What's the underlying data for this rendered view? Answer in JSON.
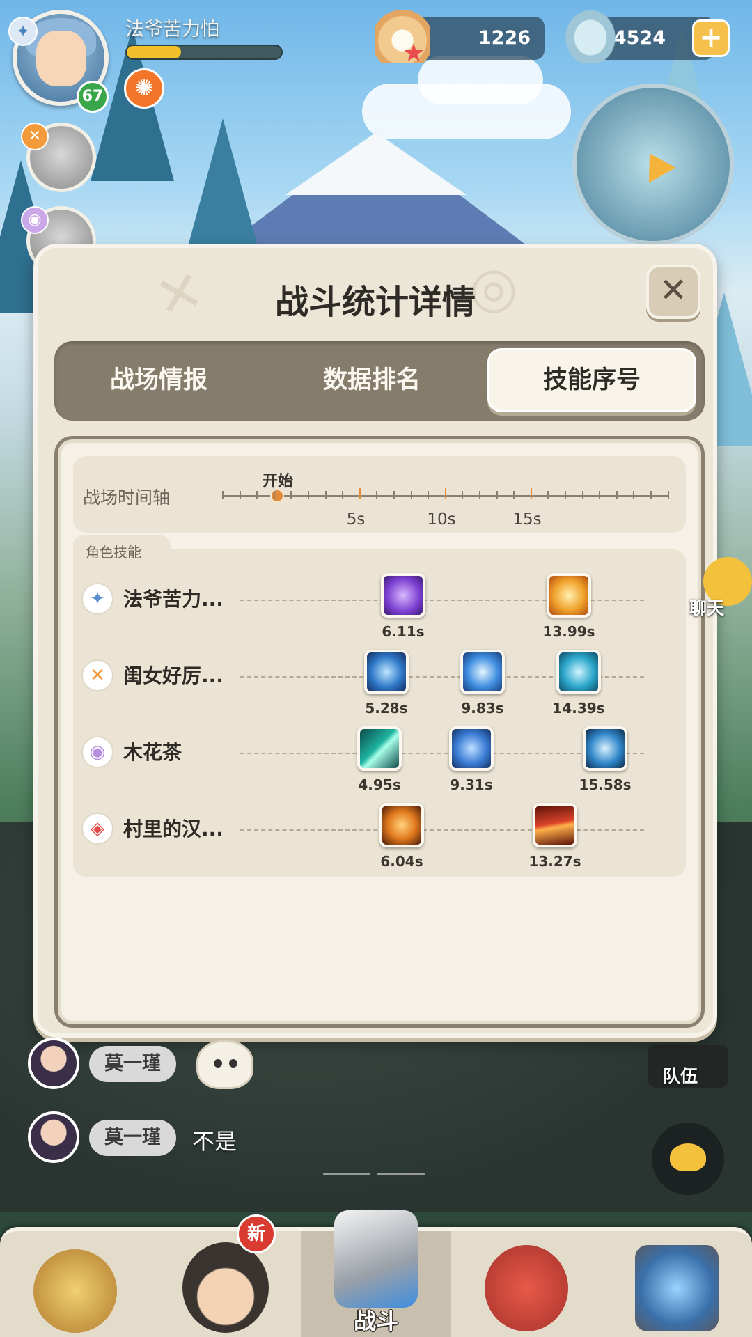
{
  "player": {
    "name": "法爷苦力怕",
    "level": "67",
    "hp_fraction": 0.35
  },
  "currency": {
    "pearl": "1226",
    "shell": "4524"
  },
  "modal": {
    "title": "战斗统计详情",
    "tabs": [
      {
        "label": "战场情报",
        "active": false
      },
      {
        "label": "数据排名",
        "active": false
      },
      {
        "label": "技能序号",
        "active": true
      }
    ],
    "timeline": {
      "label": "战场时间轴",
      "start_label": "开始",
      "ticks": [
        "5s",
        "10s",
        "15s"
      ]
    },
    "skills_header": "角色技能",
    "rows": [
      {
        "name": "法爷苦力...",
        "skills": [
          {
            "time": "6.11s",
            "color": "#7b3fd1"
          },
          {
            "time": "13.99s",
            "color": "#f0a12a"
          }
        ]
      },
      {
        "name": "闺女好厉...",
        "skills": [
          {
            "time": "5.28s",
            "color": "#2f79c9"
          },
          {
            "time": "9.83s",
            "color": "#3f8ee0"
          },
          {
            "time": "14.39s",
            "color": "#2aa6c9"
          }
        ]
      },
      {
        "name": "木花茶",
        "skills": [
          {
            "time": "4.95s",
            "color": "#1fb3a0"
          },
          {
            "time": "9.31s",
            "color": "#3a7bd5"
          },
          {
            "time": "15.58s",
            "color": "#2f86c9"
          }
        ]
      },
      {
        "name": "村里的汉...",
        "skills": [
          {
            "time": "6.04s",
            "color": "#e27a1e"
          },
          {
            "time": "13.27s",
            "color": "#d9432a"
          }
        ]
      }
    ]
  },
  "chat": {
    "messages": [
      {
        "sender": "莫一瑾",
        "text": ""
      },
      {
        "sender": "莫一瑾",
        "text": "不是"
      }
    ],
    "side_chat_label": "聊天",
    "team_label": "队伍"
  },
  "bottom_nav": {
    "battle_label": "战斗",
    "new_badge": "新"
  },
  "colors": {
    "accent": "#e08a3a",
    "panel_bg": "#ece6d7",
    "tab_bar": "#867c6c"
  }
}
